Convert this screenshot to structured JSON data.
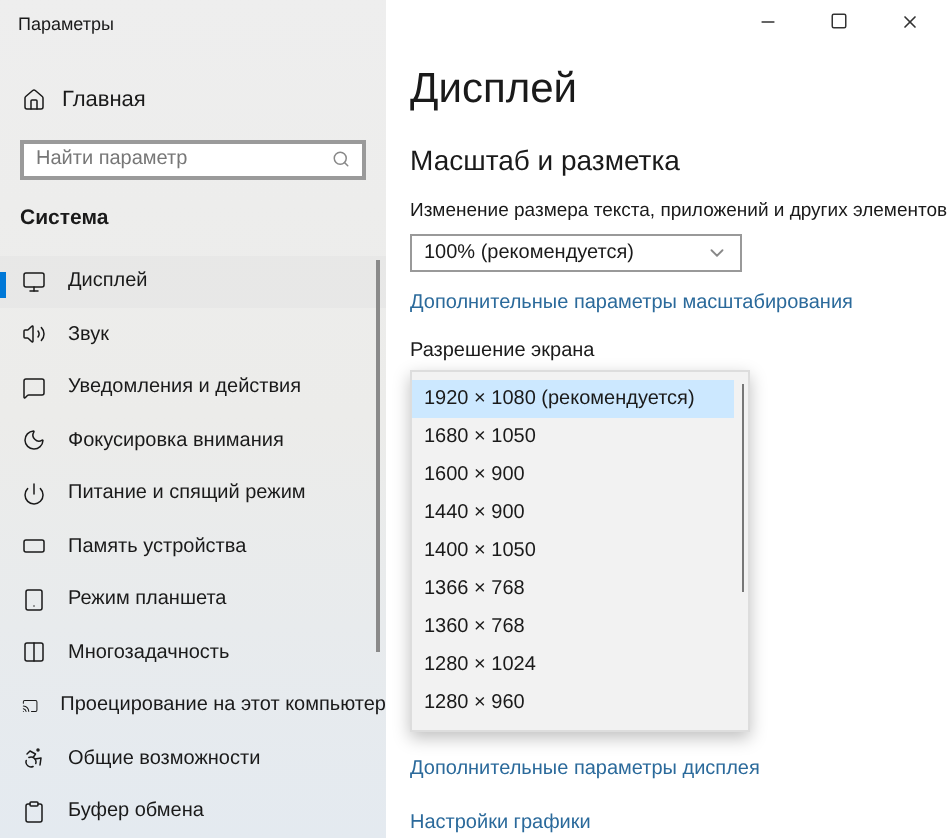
{
  "window": {
    "title": "Параметры"
  },
  "sidebar": {
    "home": "Главная",
    "search": {
      "placeholder": "Найти параметр"
    },
    "section": "Система",
    "items": [
      {
        "label": "Дисплей",
        "selected": true
      },
      {
        "label": "Звук",
        "selected": false
      },
      {
        "label": "Уведомления и действия",
        "selected": false
      },
      {
        "label": "Фокусировка внимания",
        "selected": false
      },
      {
        "label": "Питание и спящий режим",
        "selected": false
      },
      {
        "label": "Память устройства",
        "selected": false
      },
      {
        "label": "Режим планшета",
        "selected": false
      },
      {
        "label": "Многозадачность",
        "selected": false
      },
      {
        "label": "Проецирование на этот компьютер",
        "selected": false
      },
      {
        "label": "Общие возможности",
        "selected": false
      },
      {
        "label": "Буфер обмена",
        "selected": false
      }
    ]
  },
  "content": {
    "title": "Дисплей",
    "section": "Масштаб и разметка",
    "scale_label": "Изменение размера текста, приложений и других элементов",
    "scale_value": "100% (рекомендуется)",
    "scale_link": "Дополнительные параметры масштабирования",
    "resolution_label": "Разрешение экрана",
    "resolution_options": [
      {
        "label": "1920 × 1080 (рекомендуется)",
        "selected": true
      },
      {
        "label": "1680 × 1050",
        "selected": false
      },
      {
        "label": "1600 × 900",
        "selected": false
      },
      {
        "label": "1440 × 900",
        "selected": false
      },
      {
        "label": "1400 × 1050",
        "selected": false
      },
      {
        "label": "1366 × 768",
        "selected": false
      },
      {
        "label": "1360 × 768",
        "selected": false
      },
      {
        "label": "1280 × 1024",
        "selected": false
      },
      {
        "label": "1280 × 960",
        "selected": false
      }
    ],
    "links": [
      "Дополнительные параметры дисплея",
      "Настройки графики"
    ]
  }
}
